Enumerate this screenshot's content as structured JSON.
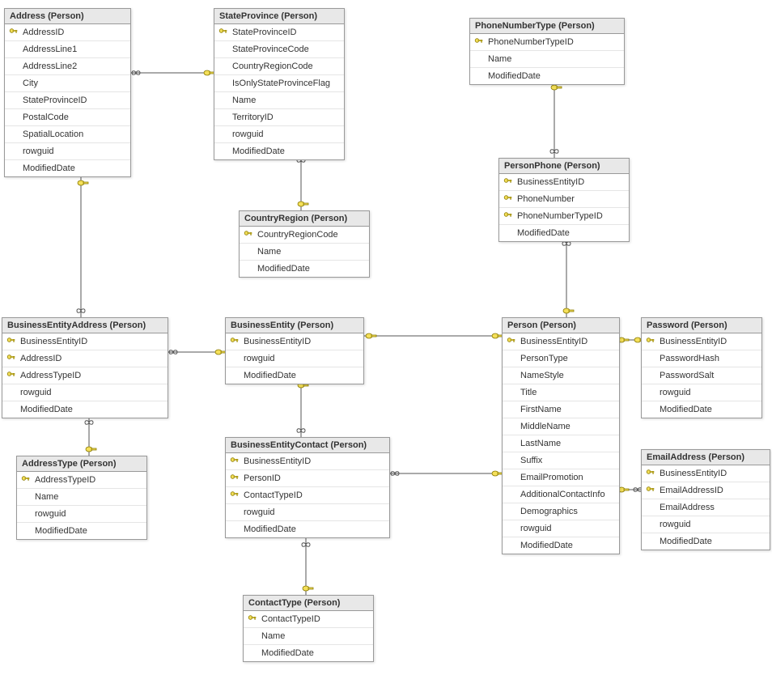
{
  "tables": {
    "address": {
      "title": "Address (Person)",
      "columns": [
        {
          "name": "AddressID",
          "pk": true
        },
        {
          "name": "AddressLine1",
          "pk": false
        },
        {
          "name": "AddressLine2",
          "pk": false
        },
        {
          "name": "City",
          "pk": false
        },
        {
          "name": "StateProvinceID",
          "pk": false
        },
        {
          "name": "PostalCode",
          "pk": false
        },
        {
          "name": "SpatialLocation",
          "pk": false
        },
        {
          "name": "rowguid",
          "pk": false
        },
        {
          "name": "ModifiedDate",
          "pk": false
        }
      ]
    },
    "stateProvince": {
      "title": "StateProvince (Person)",
      "columns": [
        {
          "name": "StateProvinceID",
          "pk": true
        },
        {
          "name": "StateProvinceCode",
          "pk": false
        },
        {
          "name": "CountryRegionCode",
          "pk": false
        },
        {
          "name": "IsOnlyStateProvinceFlag",
          "pk": false
        },
        {
          "name": "Name",
          "pk": false
        },
        {
          "name": "TerritoryID",
          "pk": false
        },
        {
          "name": "rowguid",
          "pk": false
        },
        {
          "name": "ModifiedDate",
          "pk": false
        }
      ]
    },
    "phoneNumberType": {
      "title": "PhoneNumberType (Person)",
      "columns": [
        {
          "name": "PhoneNumberTypeID",
          "pk": true
        },
        {
          "name": "Name",
          "pk": false
        },
        {
          "name": "ModifiedDate",
          "pk": false
        }
      ]
    },
    "countryRegion": {
      "title": "CountryRegion (Person)",
      "columns": [
        {
          "name": "CountryRegionCode",
          "pk": true
        },
        {
          "name": "Name",
          "pk": false
        },
        {
          "name": "ModifiedDate",
          "pk": false
        }
      ]
    },
    "personPhone": {
      "title": "PersonPhone (Person)",
      "columns": [
        {
          "name": "BusinessEntityID",
          "pk": true
        },
        {
          "name": "PhoneNumber",
          "pk": true
        },
        {
          "name": "PhoneNumberTypeID",
          "pk": true
        },
        {
          "name": "ModifiedDate",
          "pk": false
        }
      ]
    },
    "businessEntityAddress": {
      "title": "BusinessEntityAddress (Person)",
      "columns": [
        {
          "name": "BusinessEntityID",
          "pk": true
        },
        {
          "name": "AddressID",
          "pk": true
        },
        {
          "name": "AddressTypeID",
          "pk": true
        },
        {
          "name": "rowguid",
          "pk": false
        },
        {
          "name": "ModifiedDate",
          "pk": false
        }
      ]
    },
    "businessEntity": {
      "title": "BusinessEntity (Person)",
      "columns": [
        {
          "name": "BusinessEntityID",
          "pk": true
        },
        {
          "name": "rowguid",
          "pk": false
        },
        {
          "name": "ModifiedDate",
          "pk": false
        }
      ]
    },
    "person": {
      "title": "Person (Person)",
      "columns": [
        {
          "name": "BusinessEntityID",
          "pk": true
        },
        {
          "name": "PersonType",
          "pk": false
        },
        {
          "name": "NameStyle",
          "pk": false
        },
        {
          "name": "Title",
          "pk": false
        },
        {
          "name": "FirstName",
          "pk": false
        },
        {
          "name": "MiddleName",
          "pk": false
        },
        {
          "name": "LastName",
          "pk": false
        },
        {
          "name": "Suffix",
          "pk": false
        },
        {
          "name": "EmailPromotion",
          "pk": false
        },
        {
          "name": "AdditionalContactInfo",
          "pk": false
        },
        {
          "name": "Demographics",
          "pk": false
        },
        {
          "name": "rowguid",
          "pk": false
        },
        {
          "name": "ModifiedDate",
          "pk": false
        }
      ]
    },
    "password": {
      "title": "Password (Person)",
      "columns": [
        {
          "name": "BusinessEntityID",
          "pk": true
        },
        {
          "name": "PasswordHash",
          "pk": false
        },
        {
          "name": "PasswordSalt",
          "pk": false
        },
        {
          "name": "rowguid",
          "pk": false
        },
        {
          "name": "ModifiedDate",
          "pk": false
        }
      ]
    },
    "addressType": {
      "title": "AddressType (Person)",
      "columns": [
        {
          "name": "AddressTypeID",
          "pk": true
        },
        {
          "name": "Name",
          "pk": false
        },
        {
          "name": "rowguid",
          "pk": false
        },
        {
          "name": "ModifiedDate",
          "pk": false
        }
      ]
    },
    "businessEntityContact": {
      "title": "BusinessEntityContact (Person)",
      "columns": [
        {
          "name": "BusinessEntityID",
          "pk": true
        },
        {
          "name": "PersonID",
          "pk": true
        },
        {
          "name": "ContactTypeID",
          "pk": true
        },
        {
          "name": "rowguid",
          "pk": false
        },
        {
          "name": "ModifiedDate",
          "pk": false
        }
      ]
    },
    "emailAddress": {
      "title": "EmailAddress (Person)",
      "columns": [
        {
          "name": "BusinessEntityID",
          "pk": true
        },
        {
          "name": "EmailAddressID",
          "pk": true
        },
        {
          "name": "EmailAddress",
          "pk": false
        },
        {
          "name": "rowguid",
          "pk": false
        },
        {
          "name": "ModifiedDate",
          "pk": false
        }
      ]
    },
    "contactType": {
      "title": "ContactType (Person)",
      "columns": [
        {
          "name": "ContactTypeID",
          "pk": true
        },
        {
          "name": "Name",
          "pk": false
        },
        {
          "name": "ModifiedDate",
          "pk": false
        }
      ]
    }
  }
}
